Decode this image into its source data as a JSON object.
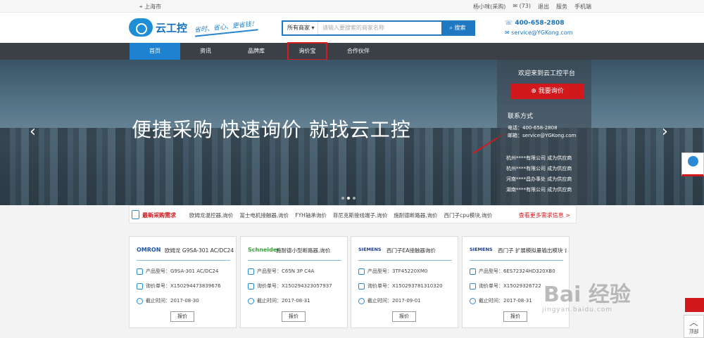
{
  "topbar": {
    "location": "上海市",
    "user": "杨小咪(采购)",
    "messages": "(73)",
    "logout": "退出",
    "service": "服务",
    "mobile": "手机端"
  },
  "header": {
    "logo_text": "云工控",
    "slogan": "省时、省心、更省钱！",
    "search_select": "所有商家",
    "search_placeholder": "请输入要搜索的商家名称",
    "search_button": "搜索",
    "phone": "400-658-2808",
    "email": "service@YGKong.com"
  },
  "nav": {
    "items": [
      "首页",
      "资讯",
      "品牌库",
      "询价宝",
      "合作伙伴"
    ]
  },
  "banner": {
    "headline": "便捷采购 快速询价 就找云工控",
    "welcome": "欢迎来到云工控平台",
    "ask_button": "我要询价",
    "contact_title": "联系方式",
    "phone_line": "电话：400-658-2808",
    "email_line": "邮箱：service@YGKong.com",
    "suppliers": [
      "杭州****有限公司 成为供应商",
      "杭州****有限公司 成为供应商",
      "河南****昌办事处 成为供应商",
      "湖南****有限公司 成为供应商"
    ]
  },
  "ticker": {
    "title": "最新采购需求",
    "items": [
      "欧姆龙温控器,询价",
      "富士电机接触器,询价",
      "FYH轴承询价",
      "菲尼克斯接线端子,询价",
      "施耐德断路器,询价",
      "西门子cpu模块,询价"
    ],
    "more": "查看更多需求信息 >"
  },
  "cards": [
    {
      "brand": "OMRON",
      "title": "欧姆龙 G9SA-301 AC/DC24 ...",
      "model": "产品型号：G9SA-301 AC/DC24",
      "order": "询价单号：X150294473839676",
      "deadline": "截止时间：2017-08-30",
      "quote": "报价"
    },
    {
      "brand": "Schneider",
      "title": "施耐德小型断路器,询价",
      "model": "产品型号：C65N 3P C4A",
      "order": "询价单号：X150294323057937",
      "deadline": "截止时间：2017-08-31",
      "quote": "报价"
    },
    {
      "brand": "SIEMENS",
      "title": "西门子EA接触器询价",
      "model": "产品型号：3TF45220XM0",
      "order": "询价单号：X150293781310320",
      "deadline": "截止时间：2017-09-01",
      "quote": "报价"
    },
    {
      "brand": "SIEMENS",
      "title": "西门子 扩展模拟量输出模块 询...",
      "model": "产品型号：6ES72324HD320XB0",
      "order": "询价单号：X15029326722",
      "deadline": "截止时间：2017-08-31",
      "quote": "报价"
    }
  ],
  "float": {
    "top_label": "顶部"
  },
  "watermark": {
    "text": "Bai 经验",
    "sub": "jingyan.baidu.com"
  }
}
